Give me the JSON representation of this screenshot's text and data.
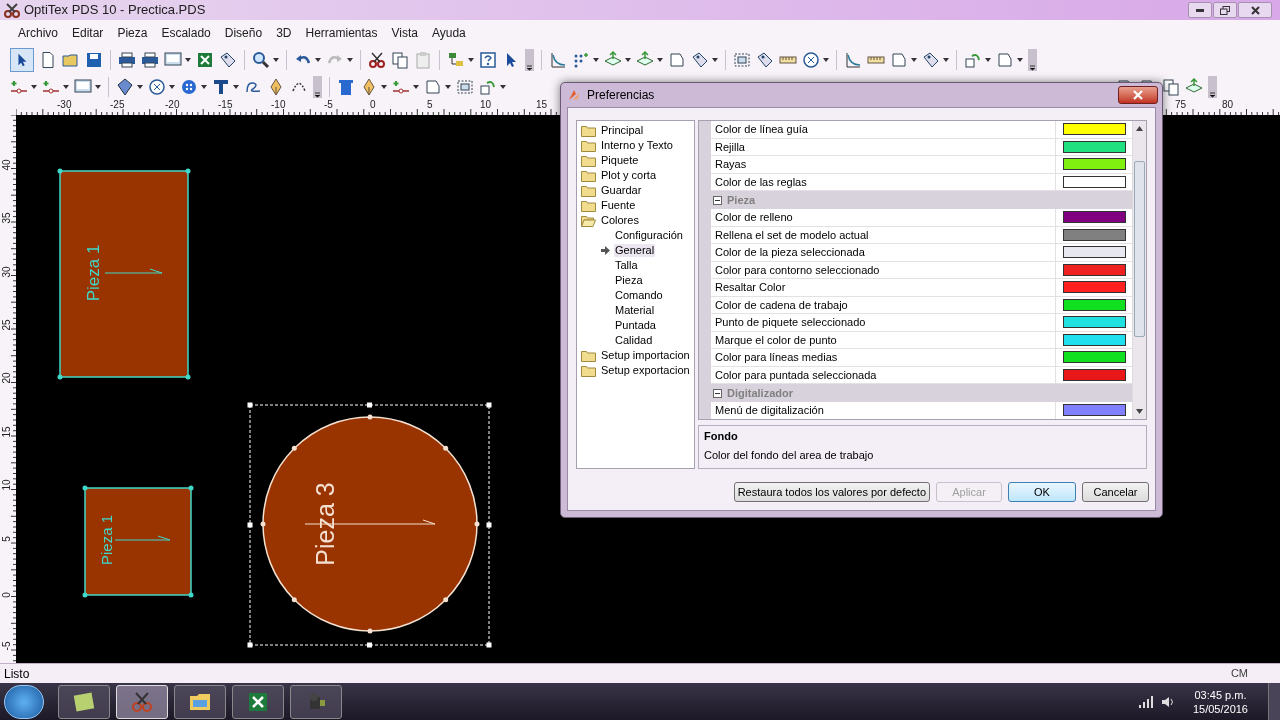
{
  "window": {
    "title": "OptiTex PDS 10 - Prectica.PDS"
  },
  "menu": [
    "Archivo",
    "Editar",
    "Pieza",
    "Escalado",
    "Diseño",
    "3D",
    "Herramientas",
    "Vista",
    "Ayuda"
  ],
  "top_ruler": [
    "-30",
    "-25",
    "-20",
    "-15",
    "-10",
    "-5",
    "0",
    "5",
    "10",
    "15",
    "75",
    "80"
  ],
  "left_ruler": [
    "40",
    "35",
    "30",
    "25",
    "20",
    "15",
    "10",
    "5",
    "0",
    "-5"
  ],
  "canvas": {
    "pieces": [
      {
        "kind": "rectangle",
        "label": "Pieza 1",
        "selected": false
      },
      {
        "kind": "rectangle",
        "label": "Pieza 1",
        "selected": false
      },
      {
        "kind": "circle",
        "label": "Pieza 3",
        "selected": true
      }
    ]
  },
  "dialog": {
    "title": "Preferencias",
    "tree": [
      {
        "label": "Principal",
        "selected": false
      },
      {
        "label": "Interno y Texto",
        "selected": false
      },
      {
        "label": "Piquete",
        "selected": false
      },
      {
        "label": "Plot y corta",
        "selected": false
      },
      {
        "label": "Guardar",
        "selected": false
      },
      {
        "label": "Fuente",
        "selected": false
      },
      {
        "label": "Colores",
        "selected": false,
        "expanded": true,
        "children": [
          {
            "label": "Configuración",
            "selected": false
          },
          {
            "label": "General",
            "selected": true
          },
          {
            "label": "Talla",
            "selected": false
          },
          {
            "label": "Pieza",
            "selected": false
          },
          {
            "label": "Comando",
            "selected": false
          },
          {
            "label": "Material",
            "selected": false
          },
          {
            "label": "Puntada",
            "selected": false
          },
          {
            "label": "Calidad",
            "selected": false
          }
        ]
      },
      {
        "label": "Setup importacion",
        "selected": false
      },
      {
        "label": "Setup exportacion",
        "selected": false
      }
    ],
    "groups": [
      {
        "rows": [
          {
            "label": "Color de línea guía",
            "color": "#ffff00"
          },
          {
            "label": "Rejilla",
            "color": "#20e080"
          },
          {
            "label": "Rayas",
            "color": "#80f010"
          },
          {
            "label": "Color de las reglas",
            "color": "#ffffff"
          }
        ]
      },
      {
        "title": "Pieza",
        "expanded": true,
        "rows": [
          {
            "label": "Color de relleno",
            "color": "#800080"
          },
          {
            "label": "Rellena el set de modelo actual",
            "color": "#808080"
          },
          {
            "label": "Color de la pieza seleccionada",
            "color": "#e8e8f0"
          },
          {
            "label": "Color para contorno seleccionado",
            "color": "#ee2020"
          },
          {
            "label": "Resaltar Color",
            "color": "#ff2020"
          },
          {
            "label": "Color de cadena de trabajo",
            "color": "#10e020"
          },
          {
            "label": "Punto de piquete seleccionado",
            "color": "#20e0e0"
          },
          {
            "label": "Marque el color de punto",
            "color": "#20e0f0"
          },
          {
            "label": "Color para líneas medias",
            "color": "#10e020"
          },
          {
            "label": "Color para puntada seleccionada",
            "color": "#e81818"
          }
        ]
      },
      {
        "title": "Digitalizador",
        "expanded": true,
        "rows": [
          {
            "label": "Menú de digitalización",
            "color": "#8080ff"
          }
        ]
      }
    ],
    "description": {
      "title": "Fondo",
      "text": "Color del fondo del area de trabajo"
    },
    "buttons": [
      {
        "label": "Restaura todos los valores por defecto",
        "disabled": false,
        "default": false
      },
      {
        "label": "Aplicar",
        "disabled": true,
        "default": false
      },
      {
        "label": "OK",
        "disabled": false,
        "default": true
      },
      {
        "label": "Cancelar",
        "disabled": false,
        "default": false
      }
    ]
  },
  "status_bar": {
    "text": "Listo",
    "units": "CM"
  },
  "taskbar": {
    "clock_time": "03:45 p.m.",
    "clock_date": "15/05/2016"
  }
}
